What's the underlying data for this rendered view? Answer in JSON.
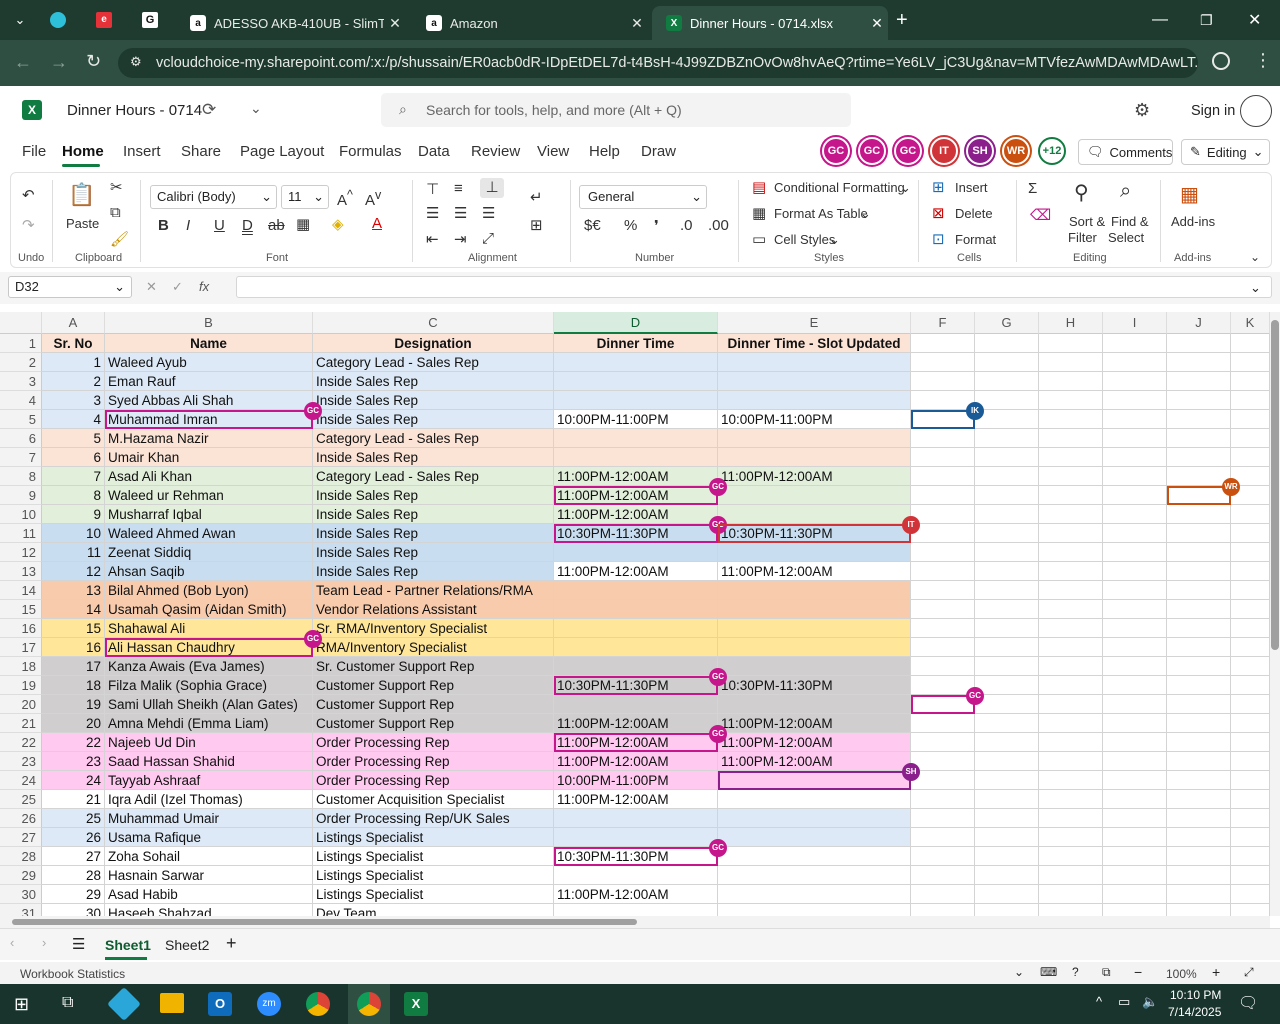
{
  "browser": {
    "tabs": [
      {
        "title": "ADESSO AKB-410UB - SlimTouc",
        "icon": "amazon-icon"
      },
      {
        "title": "Amazon",
        "icon": "amazon-icon"
      },
      {
        "title": "Dinner Hours - 0714.xlsx",
        "icon": "excel-icon"
      }
    ],
    "url": "vcloudchoice-my.sharepoint.com/:x:/p/shussain/ER0acb0dR-IDpEtDEL7d-t4BsH-4J99ZDBZnOvOw8hvAeQ?rtime=Ye6LV_jC3Ug&nav=MTVfezAwMDAwMDAwLT..."
  },
  "app": {
    "filename": "Dinner Hours - 0714",
    "search_placeholder": "Search for tools, help, and more (Alt + Q)",
    "sign_in": "Sign in",
    "comments": "Comments",
    "editing": "Editing",
    "presence_more": "+12",
    "collaborators": [
      {
        "initials": "GC",
        "color": "#c5168b"
      },
      {
        "initials": "GC",
        "color": "#c5168b"
      },
      {
        "initials": "GC",
        "color": "#c5168b"
      },
      {
        "initials": "IT",
        "color": "#d13438"
      },
      {
        "initials": "SH",
        "color": "#8b1f8b"
      },
      {
        "initials": "WR",
        "color": "#ca5010"
      }
    ]
  },
  "menu": [
    "File",
    "Home",
    "Insert",
    "Share",
    "Page Layout",
    "Formulas",
    "Data",
    "Review",
    "View",
    "Help",
    "Draw"
  ],
  "ribbon": {
    "paste": "Paste",
    "font_name": "Calibri (Body)",
    "font_size": "11",
    "number_format": "General",
    "cond_format": "Conditional Formatting",
    "format_table": "Format As Table",
    "cell_styles": "Cell Styles",
    "insert": "Insert",
    "delete": "Delete",
    "format": "Format",
    "sort_filter_1": "Sort &",
    "sort_filter_2": "Filter",
    "find_select_1": "Find &",
    "find_select_2": "Select",
    "addins": "Add-ins",
    "groups": {
      "undo": "Undo",
      "clipboard": "Clipboard",
      "font": "Font",
      "alignment": "Alignment",
      "number": "Number",
      "styles": "Styles",
      "cells": "Cells",
      "editing": "Editing",
      "addins": "Add-ins"
    }
  },
  "formula_bar": {
    "name_box": "D32",
    "fx": "fx",
    "content": ""
  },
  "columns": [
    "A",
    "B",
    "C",
    "D",
    "E",
    "F",
    "G",
    "H",
    "I",
    "J",
    "K"
  ],
  "header_row": {
    "a": "Sr. No",
    "b": "Name",
    "c": "Designation",
    "d": "Dinner Time",
    "e": "Dinner Time - Slot Updated"
  },
  "rows": [
    {
      "r": "2",
      "a": "1",
      "b": "Waleed Ayub",
      "c": "Category Lead - Sales Rep",
      "d": "",
      "e": "",
      "bg": "#dde9f6"
    },
    {
      "r": "3",
      "a": "2",
      "b": "Eman Rauf",
      "c": "Inside Sales Rep",
      "d": "",
      "e": "",
      "bg": "#dde9f6"
    },
    {
      "r": "4",
      "a": "3",
      "b": "Syed Abbas Ali Shah",
      "c": "Inside Sales Rep",
      "d": "",
      "e": "",
      "bg": "#dde9f6"
    },
    {
      "r": "5",
      "a": "4",
      "b": "Muhammad Imran",
      "c": "Inside Sales Rep",
      "d": "10:00PM-11:00PM",
      "e": "10:00PM-11:00PM",
      "bg": "#dde9f6",
      "de_bg": "#ffffff"
    },
    {
      "r": "6",
      "a": "5",
      "b": "M.Hazama Nazir",
      "c": "Category Lead - Sales Rep",
      "d": "",
      "e": "",
      "bg": "#fbe3d6"
    },
    {
      "r": "7",
      "a": "6",
      "b": "Umair Khan",
      "c": "Inside Sales Rep",
      "d": "",
      "e": "",
      "bg": "#fbe3d6"
    },
    {
      "r": "8",
      "a": "7",
      "b": "Asad Ali Khan",
      "c": "Category Lead - Sales Rep",
      "d": "11:00PM-12:00AM",
      "e": "11:00PM-12:00AM",
      "bg": "#e2efda"
    },
    {
      "r": "9",
      "a": "8",
      "b": "Waleed ur Rehman",
      "c": "Inside Sales Rep",
      "d": "11:00PM-12:00AM",
      "e": "",
      "bg": "#e2efda"
    },
    {
      "r": "10",
      "a": "9",
      "b": "Musharraf Iqbal",
      "c": "Inside Sales Rep",
      "d": "11:00PM-12:00AM",
      "e": "",
      "bg": "#e2efda"
    },
    {
      "r": "11",
      "a": "10",
      "b": "Waleed Ahmed Awan",
      "c": "Inside Sales Rep",
      "d": "10:30PM-11:30PM",
      "e": "10:30PM-11:30PM",
      "bg": "#c9ddf0"
    },
    {
      "r": "12",
      "a": "11",
      "b": "Zeenat Siddiq",
      "c": "Inside Sales Rep",
      "d": "",
      "e": "",
      "bg": "#c9ddf0"
    },
    {
      "r": "13",
      "a": "12",
      "b": "Ahsan Saqib",
      "c": "Inside Sales Rep",
      "d": "11:00PM-12:00AM",
      "e": "11:00PM-12:00AM",
      "bg": "#c9ddf0",
      "de_bg": "#ffffff"
    },
    {
      "r": "14",
      "a": "13",
      "b": "Bilal Ahmed (Bob Lyon)",
      "c": "Team Lead - Partner Relations/RMA",
      "d": "",
      "e": "",
      "bg": "#f8cbad"
    },
    {
      "r": "15",
      "a": "14",
      "b": "Usamah Qasim (Aidan Smith)",
      "c": "Vendor Relations Assistant",
      "d": "",
      "e": "",
      "bg": "#f8cbad"
    },
    {
      "r": "16",
      "a": "15",
      "b": "Shahawal Ali",
      "c": "Sr. RMA/Inventory Specialist",
      "d": "",
      "e": "",
      "bg": "#ffe699"
    },
    {
      "r": "17",
      "a": "16",
      "b": "Ali Hassan Chaudhry",
      "c": "RMA/Inventory Specialist",
      "d": "",
      "e": "",
      "bg": "#ffe699"
    },
    {
      "r": "18",
      "a": "17",
      "b": "Kanza Awais (Eva James)",
      "c": "Sr. Customer Support Rep",
      "d": "",
      "e": "",
      "bg": "#d0cece"
    },
    {
      "r": "19",
      "a": "18",
      "b": "Filza Malik (Sophia Grace)",
      "c": "Customer Support Rep",
      "d": "10:30PM-11:30PM",
      "e": "10:30PM-11:30PM",
      "bg": "#d0cece"
    },
    {
      "r": "20",
      "a": "19",
      "b": "Sami Ullah Sheikh (Alan Gates)",
      "c": "Customer Support Rep",
      "d": "",
      "e": "",
      "bg": "#d0cece"
    },
    {
      "r": "21",
      "a": "20",
      "b": "Amna Mehdi (Emma Liam)",
      "c": "Customer Support Rep",
      "d": "11:00PM-12:00AM",
      "e": "11:00PM-12:00AM",
      "bg": "#d0cece"
    },
    {
      "r": "22",
      "a": "22",
      "b": "Najeeb Ud Din",
      "c": "Order Processing Rep",
      "d": "11:00PM-12:00AM",
      "e": "11:00PM-12:00AM",
      "bg": "#ffc9f0"
    },
    {
      "r": "23",
      "a": "23",
      "b": "Saad Hassan Shahid",
      "c": "Order Processing Rep",
      "d": "11:00PM-12:00AM",
      "e": "11:00PM-12:00AM",
      "bg": "#ffc9f0"
    },
    {
      "r": "24",
      "a": "24",
      "b": "Tayyab Ashraaf",
      "c": "Order Processing Rep",
      "d": "10:00PM-11:00PM",
      "e": "",
      "bg": "#ffc9f0"
    },
    {
      "r": "25",
      "a": "21",
      "b": "Iqra Adil (Izel Thomas)",
      "c": "Customer Acquisition Specialist",
      "d": "11:00PM-12:00AM",
      "e": "",
      "bg": "#ffffff"
    },
    {
      "r": "26",
      "a": "25",
      "b": "Muhammad Umair",
      "c": "Order Processing Rep/UK Sales",
      "d": "",
      "e": "",
      "bg": "#dde9f6"
    },
    {
      "r": "27",
      "a": "26",
      "b": "Usama Rafique",
      "c": "Listings Specialist",
      "d": "",
      "e": "",
      "bg": "#dde9f6"
    },
    {
      "r": "28",
      "a": "27",
      "b": "Zoha Sohail",
      "c": "Listings Specialist",
      "d": "10:30PM-11:30PM",
      "e": "",
      "bg": "#ffffff"
    },
    {
      "r": "29",
      "a": "28",
      "b": "Hasnain Sarwar",
      "c": "Listings Specialist",
      "d": "",
      "e": "",
      "bg": "#ffffff"
    },
    {
      "r": "30",
      "a": "29",
      "b": "Asad Habib",
      "c": "Listings Specialist",
      "d": "11:00PM-12:00AM",
      "e": "",
      "bg": "#ffffff"
    },
    {
      "r": "31",
      "a": "30",
      "b": "Haseeb Shahzad",
      "c": "Dev Team",
      "d": "",
      "e": "",
      "bg": "#ffffff"
    }
  ],
  "sheets": [
    "Sheet1",
    "Sheet2"
  ],
  "status": {
    "left": "Workbook Statistics",
    "zoom": "100%"
  },
  "taskbar": {
    "time": "10:10 PM",
    "date": "7/14/2025"
  }
}
